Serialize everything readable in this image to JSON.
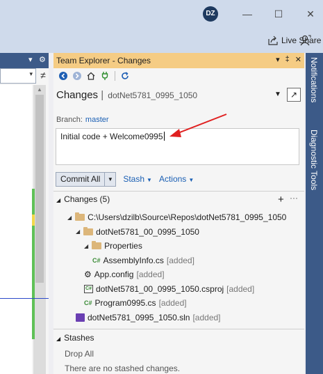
{
  "window": {
    "avatar_initials": "DZ",
    "minimize_glyph": "—",
    "maximize_glyph": "☐",
    "close_glyph": "✕",
    "live_share_label": "Live Share"
  },
  "left_panel": {
    "header_dd_glyph": "▾",
    "header_gear_glyph": "⚙",
    "split_glyph": "≠"
  },
  "team_explorer": {
    "header_title": "Team Explorer - Changes",
    "page_title": "Changes",
    "page_separator": "|",
    "page_subtitle": "dotNet5781_0995_1050",
    "branch_label": "Branch:",
    "branch_value": "master",
    "commit_message": "Initial code + Welcome0995",
    "commit_button": "Commit All",
    "stash_link": "Stash",
    "actions_link": "Actions",
    "changes_section": {
      "title": "Changes (5)",
      "tree": [
        {
          "indent": 1,
          "expander": "◢",
          "icon": "folder-icon",
          "name": "C:\\Users\\dzilb\\Source\\Repos\\dotNet5781_0995_1050",
          "status": ""
        },
        {
          "indent": 2,
          "expander": "◢",
          "icon": "folder-icon",
          "name": "dotNet5781_00_0995_1050",
          "status": ""
        },
        {
          "indent": 3,
          "expander": "◢",
          "icon": "folder-icon",
          "name": "Properties",
          "status": ""
        },
        {
          "indent": 4,
          "expander": "",
          "icon": "csharp-file-icon",
          "name": "AssemblyInfo.cs",
          "status": "[added]"
        },
        {
          "indent": 3,
          "expander": "",
          "icon": "config-file-icon",
          "name": "App.config",
          "status": "[added]"
        },
        {
          "indent": 3,
          "expander": "",
          "icon": "csproj-file-icon",
          "name": "dotNet5781_00_0995_1050.csproj",
          "status": "[added]"
        },
        {
          "indent": 3,
          "expander": "",
          "icon": "csharp-file-icon",
          "name": "Program0995.cs",
          "status": "[added]"
        },
        {
          "indent": 2,
          "expander": "",
          "icon": "solution-file-icon",
          "name": "dotNet5781_0995_1050.sln",
          "status": "[added]"
        }
      ]
    },
    "stashes_section": {
      "title": "Stashes",
      "drop_all": "Drop All",
      "empty_message": "There are no stashed changes."
    }
  },
  "side_tabs": {
    "notifications": "Notifications",
    "diagnostic_tools": "Diagnostic Tools"
  },
  "colors": {
    "title_bar": "#cfdaeb",
    "tool_header": "#f5cc84",
    "side_tab": "#3c5a88",
    "link": "#1a5fb4",
    "annotation_arrow": "#e02020"
  }
}
